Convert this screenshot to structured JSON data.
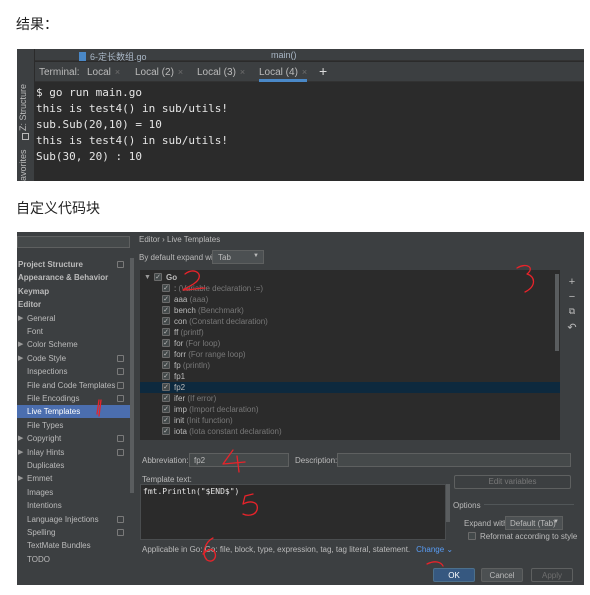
{
  "headings": {
    "result": "结果：",
    "custom_snippet": "自定义代码块"
  },
  "terminal": {
    "side_labels": [
      "Z: Structure",
      "avorites"
    ],
    "editor_file": "6-定长数组.go",
    "editor_func": "main()",
    "tab_label": "Terminal:",
    "tabs": [
      "Local",
      "Local (2)",
      "Local (3)",
      "Local (4)"
    ],
    "active_tab": "Local (4)",
    "close_glyph": "×",
    "new_tab_glyph": "+",
    "lines": [
      "$ go run main.go",
      "this is test4() in sub/utils!",
      "sub.Sub(20,10) = 10",
      "this is test4() in sub/utils!",
      "Sub(30, 20) : 10"
    ]
  },
  "settings": {
    "tree": [
      {
        "label": "Project Structure",
        "top": true,
        "copy": true
      },
      {
        "label": "Appearance & Behavior",
        "top": true
      },
      {
        "label": "Keymap",
        "top": true
      },
      {
        "label": "Editor",
        "top": true
      },
      {
        "label": "General",
        "arrow": true
      },
      {
        "label": "Font"
      },
      {
        "label": "Color Scheme",
        "arrow": true
      },
      {
        "label": "Code Style",
        "arrow": true,
        "copy": true
      },
      {
        "label": "Inspections",
        "copy": true
      },
      {
        "label": "File and Code Templates",
        "copy": true
      },
      {
        "label": "File Encodings",
        "copy": true
      },
      {
        "label": "Live Templates",
        "selected": true
      },
      {
        "label": "File Types"
      },
      {
        "label": "Copyright",
        "arrow": true,
        "copy": true
      },
      {
        "label": "Inlay Hints",
        "arrow": true,
        "copy": true
      },
      {
        "label": "Duplicates"
      },
      {
        "label": "Emmet",
        "arrow": true
      },
      {
        "label": "Images"
      },
      {
        "label": "Intentions"
      },
      {
        "label": "Language Injections",
        "copy": true
      },
      {
        "label": "Spelling",
        "copy": true
      },
      {
        "label": "TextMate Bundles"
      },
      {
        "label": "TODO"
      }
    ],
    "breadcrumb": "Editor  ›  Live Templates",
    "expand_label": "By default expand with",
    "expand_value": "Tab",
    "group": "Go",
    "templates": [
      {
        "abbr": ":",
        "desc": "(Variable declaration :=)"
      },
      {
        "abbr": "aaa",
        "desc": "(aaa)"
      },
      {
        "abbr": "bench",
        "desc": "(Benchmark)"
      },
      {
        "abbr": "con",
        "desc": "(Constant declaration)"
      },
      {
        "abbr": "ff",
        "desc": "(printf)"
      },
      {
        "abbr": "for",
        "desc": "(For loop)"
      },
      {
        "abbr": "forr",
        "desc": "(For range loop)"
      },
      {
        "abbr": "fp",
        "desc": "(println)"
      },
      {
        "abbr": "fp1",
        "desc": ""
      },
      {
        "abbr": "fp2",
        "desc": "",
        "selected": true
      },
      {
        "abbr": "ifer",
        "desc": "(If error)"
      },
      {
        "abbr": "imp",
        "desc": "(Import declaration)"
      },
      {
        "abbr": "init",
        "desc": "(Init function)"
      },
      {
        "abbr": "iota",
        "desc": "(Iota constant declaration)"
      }
    ],
    "side_buttons": [
      "+",
      "−",
      "⧉",
      "↶"
    ],
    "abbreviation_label": "Abbreviation:",
    "abbreviation_value": "fp2",
    "description_label": "Description:",
    "description_value": "",
    "template_text_label": "Template text:",
    "template_text": "fmt.Println(\"$END$\")",
    "edit_variables": "Edit variables",
    "options_label": "Options",
    "expand_with_label": "Expand with",
    "expand_with_value": "Default (Tab)",
    "reformat_label": "Reformat according to style",
    "applicable": "Applicable in Go: Go: file, block, type, expression, tag, tag literal, statement.",
    "change_link": "Change ⌄",
    "buttons": {
      "ok": "OK",
      "cancel": "Cancel",
      "apply": "Apply"
    },
    "annotation_color": "#e8232a"
  }
}
